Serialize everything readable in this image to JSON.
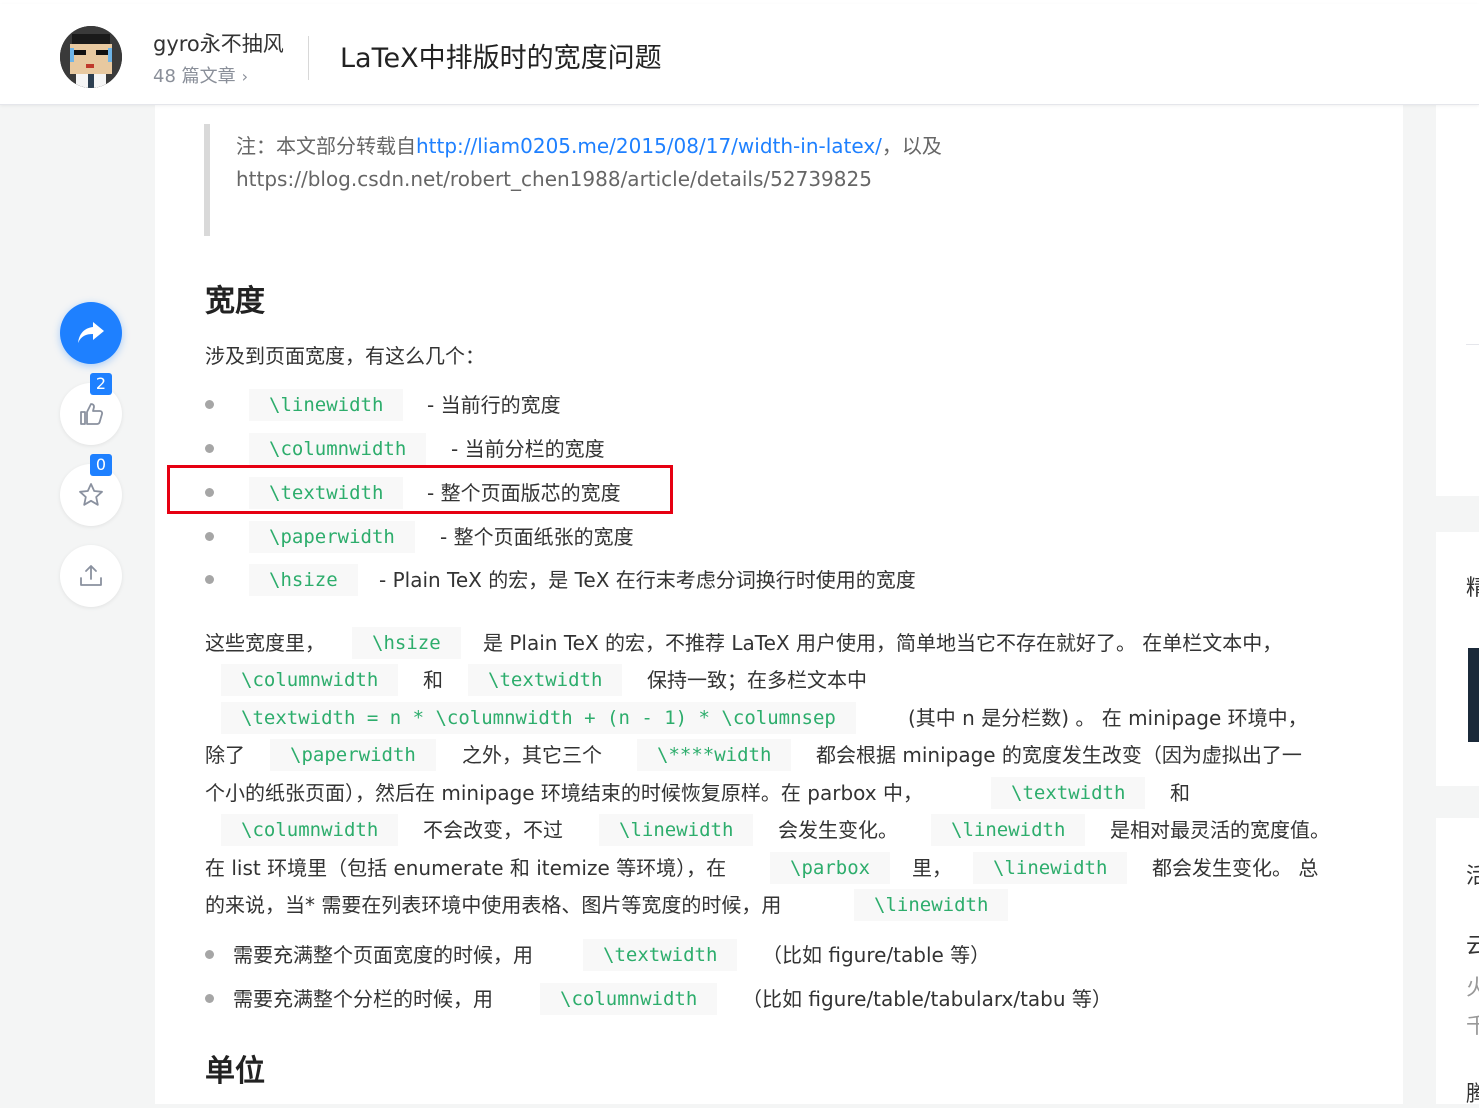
{
  "author": {
    "name": "gyro永不抽风",
    "article_count": "48 篇文章",
    "chevron": "›"
  },
  "article": {
    "title": "LaTeX中排版时的宽度问题"
  },
  "actions": {
    "like_count": "2",
    "favorite_count": "0"
  },
  "quote": {
    "prefix": "注：本文部分转载自",
    "link": "http://liam0205.me/2015/08/17/width-in-latex/",
    "suffix": "，以及",
    "line2": "https://blog.csdn.net/robert_chen1988/article/details/52739825"
  },
  "section1": {
    "heading": "宽度",
    "intro": "涉及到页面宽度，有这么几个：",
    "items": [
      {
        "code": "\\linewidth",
        "desc": "- 当前行的宽度"
      },
      {
        "code": "\\columnwidth",
        "desc": "- 当前分栏的宽度"
      },
      {
        "code": "\\textwidth",
        "desc": "- 整个页面版芯的宽度"
      },
      {
        "code": "\\paperwidth",
        "desc": "- 整个页面纸张的宽度"
      },
      {
        "code": "\\hsize",
        "desc": "- Plain TeX 的宏，是 TeX 在行末考虑分词换行时使用的宽度"
      }
    ]
  },
  "paragraph": {
    "l1_a": "这些宽度里，",
    "l1_code": "\\hsize",
    "l1_b": "是 Plain TeX 的宏，不推荐 LaTeX 用户使用，简单地当它不存在就好了。 在单栏文本中，",
    "l2_code1": "\\columnwidth",
    "l2_a": "和",
    "l2_code2": "\\textwidth",
    "l2_b": "保持一致；在多栏文本中",
    "l3_code": "\\textwidth = n * \\columnwidth + (n - 1) * \\columnsep",
    "l3_a": "(其中 n 是分栏数) 。 在 minipage 环境中，",
    "l4_a": "除了",
    "l4_code1": "\\paperwidth",
    "l4_b": "之外，其它三个",
    "l4_code2": "\\****width",
    "l4_c": "都会根据 minipage 的宽度发生改变（因为虚拟出了一",
    "l5_a": "个小的纸张页面），然后在 minipage 环境结束的时候恢复原样。在 parbox 中，",
    "l5_code": "\\textwidth",
    "l5_b": "和",
    "l6_code1": "\\columnwidth",
    "l6_a": "不会改变，不过",
    "l6_code2": "\\linewidth",
    "l6_b": "会发生变化。",
    "l6_code3": "\\linewidth",
    "l6_c": "是相对最灵活的宽度值。",
    "l7_a": "在 list 环境里（包括 enumerate 和 itemize 等环境），在",
    "l7_code1": "\\parbox",
    "l7_b": "里，",
    "l7_code2": "\\linewidth",
    "l7_c": "都会发生变化。 总",
    "l8_a": "的来说，当* 需要在列表环境中使用表格、图片等宽度的时候，用",
    "l8_code": "\\linewidth"
  },
  "usage": [
    {
      "text": "需要充满整个页面宽度的时候，用",
      "code": "\\textwidth",
      "note": "（比如 figure/table 等）"
    },
    {
      "text": "需要充满整个分栏的时候，用",
      "code": "\\columnwidth",
      "note": "（比如 figure/table/tabularx/tabu 等）"
    }
  ],
  "section2": {
    "heading": "单位"
  },
  "right_glyphs": {
    "g1": "精",
    "g2": "活",
    "g3": "云",
    "g4": "火",
    "g5": "千",
    "g6": "腾"
  },
  "colors": {
    "accent": "#1e80ff",
    "code": "#2dad6c",
    "highlight": "#e60012"
  }
}
